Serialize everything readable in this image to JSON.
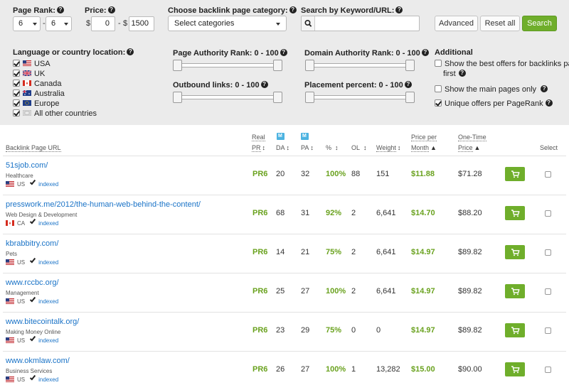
{
  "filters": {
    "page_rank": {
      "label": "Page Rank:",
      "min": "6",
      "max": "6"
    },
    "price": {
      "label": "Price:",
      "currency": "$",
      "min": "0",
      "max": "1500"
    },
    "category": {
      "label": "Choose backlink page category:",
      "value": "Select categories"
    },
    "search": {
      "label": "Search by Keyword/URL:",
      "value": ""
    },
    "buttons": {
      "advanced": "Advanced",
      "reset": "Reset all",
      "search": "Search"
    },
    "language": {
      "label": "Language or country location:",
      "items": [
        {
          "label": "USA",
          "checked": true,
          "flag": "us-flag-icon"
        },
        {
          "label": "UK",
          "checked": true,
          "flag": "uk-flag-icon"
        },
        {
          "label": "Canada",
          "checked": true,
          "flag": "ca-flag-icon"
        },
        {
          "label": "Australia",
          "checked": true,
          "flag": "au-flag-icon"
        },
        {
          "label": "Europe",
          "checked": true,
          "flag": "eu-flag-icon"
        },
        {
          "label": "All other countries",
          "checked": true,
          "flag": "globe-icon"
        }
      ]
    },
    "sliders": {
      "page_authority": {
        "label": "Page Authority Rank: 0 - 100",
        "min": 0,
        "max": 100
      },
      "domain_authority": {
        "label": "Domain Authority Rank: 0 - 100",
        "min": 0,
        "max": 100
      },
      "outbound_links": {
        "label": "Outbound links: 0 - 100",
        "min": 0,
        "max": 100
      },
      "placement_percent": {
        "label": "Placement percent: 0 - 100",
        "min": 0,
        "max": 100
      }
    },
    "additional": {
      "label": "Additional",
      "options": [
        {
          "label_line1": "Show the best offers for backlinks pages",
          "label_line2": "first",
          "checked": false
        },
        {
          "label_line1": "Show the main pages only",
          "label_line2": "",
          "checked": false
        },
        {
          "label_line1": "Unique offers per PageRank",
          "label_line2": "",
          "checked": true
        }
      ]
    }
  },
  "table": {
    "headers": {
      "url": "Backlink Page URL",
      "real": "Real",
      "pr": "PR",
      "da": "DA",
      "pa": "PA",
      "pct": "%",
      "ol": "OL",
      "weight": "Weight",
      "price_per": "Price per",
      "month": "Month",
      "one_time": "One-Time",
      "price": "Price",
      "select": "Select"
    },
    "rows": [
      {
        "url": "51sjob.com/",
        "category": "Healthcare",
        "country": "US",
        "status": "indexed",
        "pr": "PR6",
        "da": "20",
        "pa": "32",
        "pct": "100%",
        "ol": "88",
        "weight": "151",
        "monthly": "$11.88",
        "one_time": "$71.28"
      },
      {
        "url": "presswork.me/2012/the-human-web-behind-the-content/",
        "category": "Web Design & Development",
        "country": "CA",
        "status": "indexed",
        "pr": "PR6",
        "da": "68",
        "pa": "31",
        "pct": "92%",
        "ol": "2",
        "weight": "6,641",
        "monthly": "$14.70",
        "one_time": "$88.20"
      },
      {
        "url": "kbrabbitry.com/",
        "category": "Pets",
        "country": "US",
        "status": "indexed",
        "pr": "PR6",
        "da": "14",
        "pa": "21",
        "pct": "75%",
        "ol": "2",
        "weight": "6,641",
        "monthly": "$14.97",
        "one_time": "$89.82"
      },
      {
        "url": "www.rccbc.org/",
        "category": "Management",
        "country": "US",
        "status": "indexed",
        "pr": "PR6",
        "da": "25",
        "pa": "27",
        "pct": "100%",
        "ol": "2",
        "weight": "6,641",
        "monthly": "$14.97",
        "one_time": "$89.82"
      },
      {
        "url": "www.bitecointalk.org/",
        "category": "Making Money Online",
        "country": "US",
        "status": "indexed",
        "pr": "PR6",
        "da": "23",
        "pa": "29",
        "pct": "75%",
        "ol": "0",
        "weight": "0",
        "monthly": "$14.97",
        "one_time": "$89.82"
      },
      {
        "url": "www.okmlaw.com/",
        "category": "Business Services",
        "country": "US",
        "status": "indexed",
        "pr": "PR6",
        "da": "26",
        "pa": "27",
        "pct": "100%",
        "ol": "1",
        "weight": "13,282",
        "monthly": "$15.00",
        "one_time": "$90.00"
      }
    ]
  },
  "colors": {
    "accent": "#6fae2b",
    "link": "#1a73c7",
    "panel": "#ebebeb",
    "moz_badge": "#4cb3e1"
  }
}
